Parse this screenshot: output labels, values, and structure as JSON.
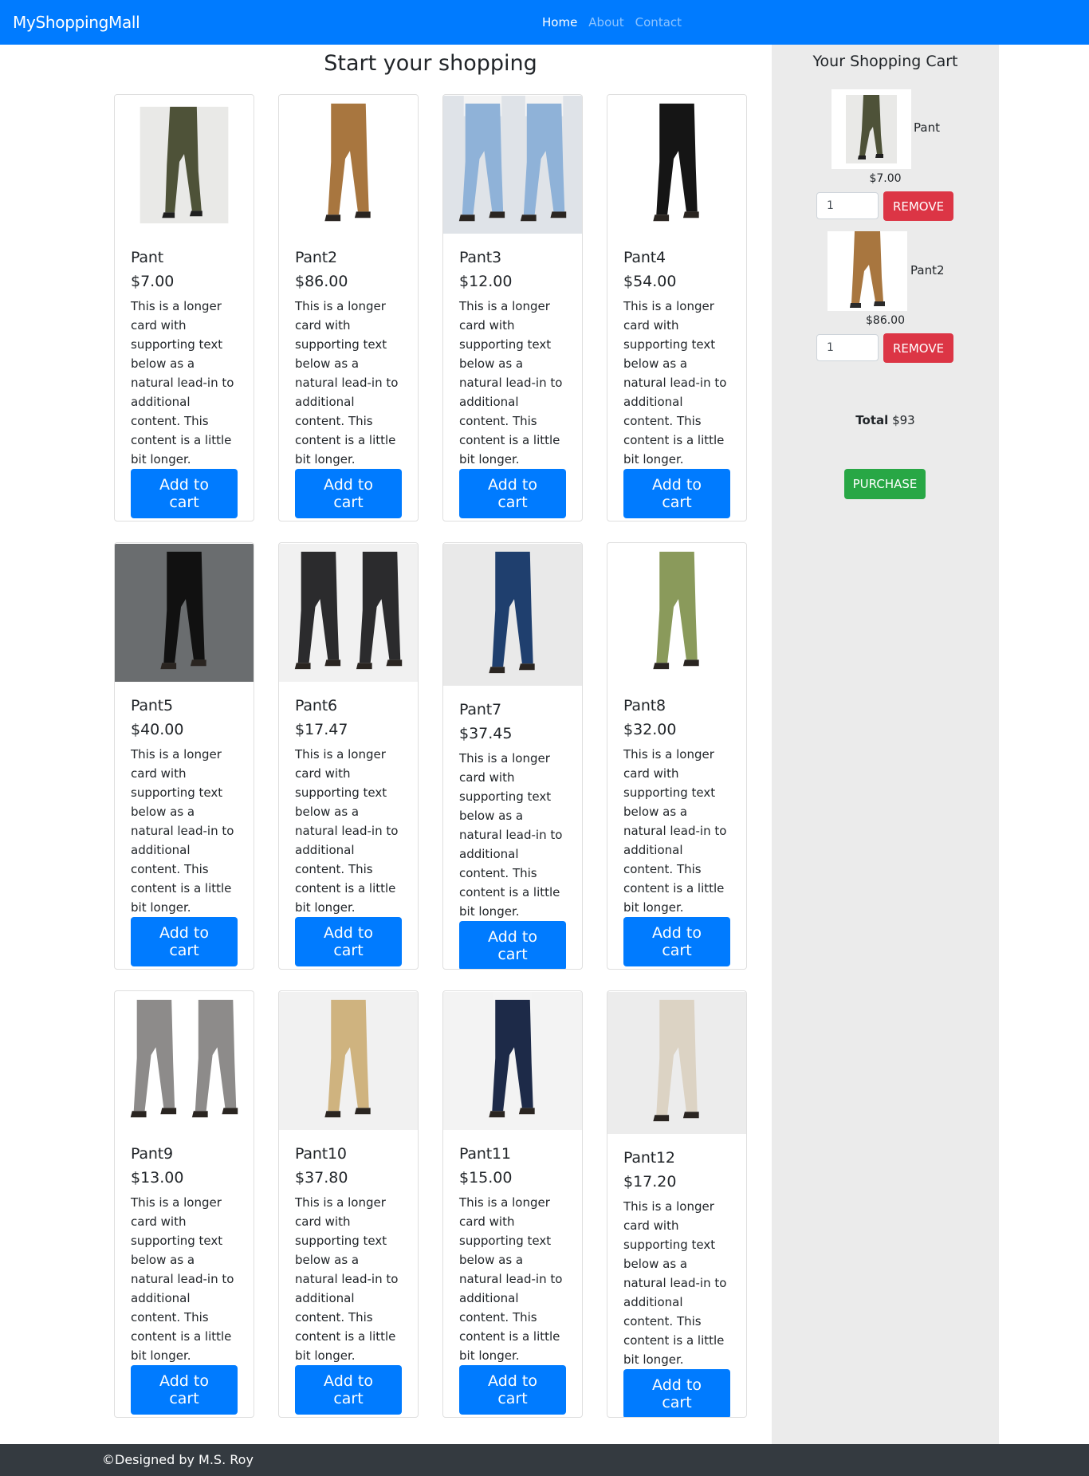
{
  "navbar": {
    "brand": "MyShoppingMall",
    "links": [
      {
        "label": "Home",
        "active": true
      },
      {
        "label": "About",
        "active": false
      },
      {
        "label": "Contact",
        "active": false
      }
    ]
  },
  "main": {
    "title": "Start your shopping",
    "add_label": "Add to cart",
    "description": "This is a longer card with supporting text below as a natural lead-in to additional content. This content is a little bit longer.",
    "products": [
      {
        "name": "Pant",
        "price": "$7.00"
      },
      {
        "name": "Pant2",
        "price": "$86.00"
      },
      {
        "name": "Pant3",
        "price": "$12.00"
      },
      {
        "name": "Pant4",
        "price": "$54.00"
      },
      {
        "name": "Pant5",
        "price": "$40.00"
      },
      {
        "name": "Pant6",
        "price": "$17.47"
      },
      {
        "name": "Pant7",
        "price": "$37.45"
      },
      {
        "name": "Pant8",
        "price": "$32.00"
      },
      {
        "name": "Pant9",
        "price": "$13.00"
      },
      {
        "name": "Pant10",
        "price": "$37.80"
      },
      {
        "name": "Pant11",
        "price": "$15.00"
      },
      {
        "name": "Pant12",
        "price": "$17.20"
      }
    ]
  },
  "cart": {
    "title": "Your Shopping Cart",
    "items": [
      {
        "name": "Pant",
        "price": "$7.00",
        "qty": "1",
        "remove_label": "REMOVE"
      },
      {
        "name": "Pant2",
        "price": "$86.00",
        "qty": "1",
        "remove_label": "REMOVE"
      }
    ],
    "total_label": "Total",
    "total_value": "$93",
    "purchase_label": "PURCHASE"
  },
  "footer": {
    "text": "©Designed by M.S. Roy"
  },
  "colors": {
    "primary": "#007bff",
    "danger": "#dc3545",
    "success": "#28a745",
    "footer": "#343a40",
    "cart_bg": "#ebebeb"
  }
}
